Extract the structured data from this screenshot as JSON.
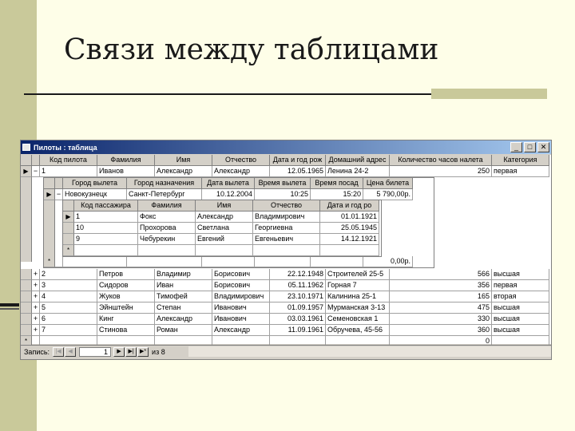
{
  "slide": {
    "title": "Связи между таблицами"
  },
  "window": {
    "title": "Пилоты : таблица",
    "buttons": {
      "min": "_",
      "max": "□",
      "close": "✕"
    }
  },
  "main": {
    "headers": [
      "Код пилота",
      "Фамилия",
      "Имя",
      "Отчество",
      "Дата и год рож",
      "Домашний адрес",
      "Количество часов налета",
      "Категория"
    ],
    "rows": [
      {
        "exp": "−",
        "cells": [
          "1",
          "Иванов",
          "Александр",
          "Александр",
          "12.05.1965",
          "Ленина 24-2",
          "250",
          "первая"
        ]
      },
      {
        "exp": "+",
        "cells": [
          "2",
          "Петров",
          "Владимир",
          "Борисович",
          "22.12.1948",
          "Строителей 25-5",
          "566",
          "высшая"
        ]
      },
      {
        "exp": "+",
        "cells": [
          "3",
          "Сидоров",
          "Иван",
          "Борисович",
          "05.11.1962",
          "Горная 7",
          "356",
          "первая"
        ]
      },
      {
        "exp": "+",
        "cells": [
          "4",
          "Жуков",
          "Тимофей",
          "Владимирович",
          "23.10.1971",
          "Калинина 25-1",
          "165",
          "вторая"
        ]
      },
      {
        "exp": "+",
        "cells": [
          "5",
          "Эйнштейн",
          "Степан",
          "Иванович",
          "01.09.1957",
          "Мурманская 3-13",
          "475",
          "высшая"
        ]
      },
      {
        "exp": "+",
        "cells": [
          "6",
          "Кинг",
          "Александр",
          "Иванович",
          "03.03.1961",
          "Семеновская 1",
          "330",
          "высшая"
        ]
      },
      {
        "exp": "+",
        "cells": [
          "7",
          "Стинова",
          "Роман",
          "Александр",
          "11.09.1961",
          "Обручева, 45-56",
          "360",
          "высшая"
        ]
      }
    ],
    "new_row_value": "0"
  },
  "sub1": {
    "headers": [
      "Город вылета",
      "Город назначения",
      "Дата вылета",
      "Время вылета",
      "Время посад",
      "Цена билета"
    ],
    "row": [
      "Новокузнецк",
      "Санкт-Петербург",
      "10.12.2004",
      "10:25",
      "15:20",
      "5 790,00р."
    ],
    "new_row_value": "0,00р."
  },
  "sub2": {
    "headers": [
      "Код пассажира",
      "Фамилия",
      "Имя",
      "Отчество",
      "Дата и год ро"
    ],
    "rows": [
      [
        "1",
        "Фокс",
        "Александр",
        "Владимирович",
        "01.01.1921"
      ],
      [
        "10",
        "Прохорова",
        "Светлана",
        "Георгиевна",
        "25.05.1945"
      ],
      [
        "9",
        "Чебурекин",
        "Евгений",
        "Евгеньевич",
        "14.12.1921"
      ]
    ]
  },
  "status": {
    "label": "Запись:",
    "current": "1",
    "of_label": "из 8"
  }
}
